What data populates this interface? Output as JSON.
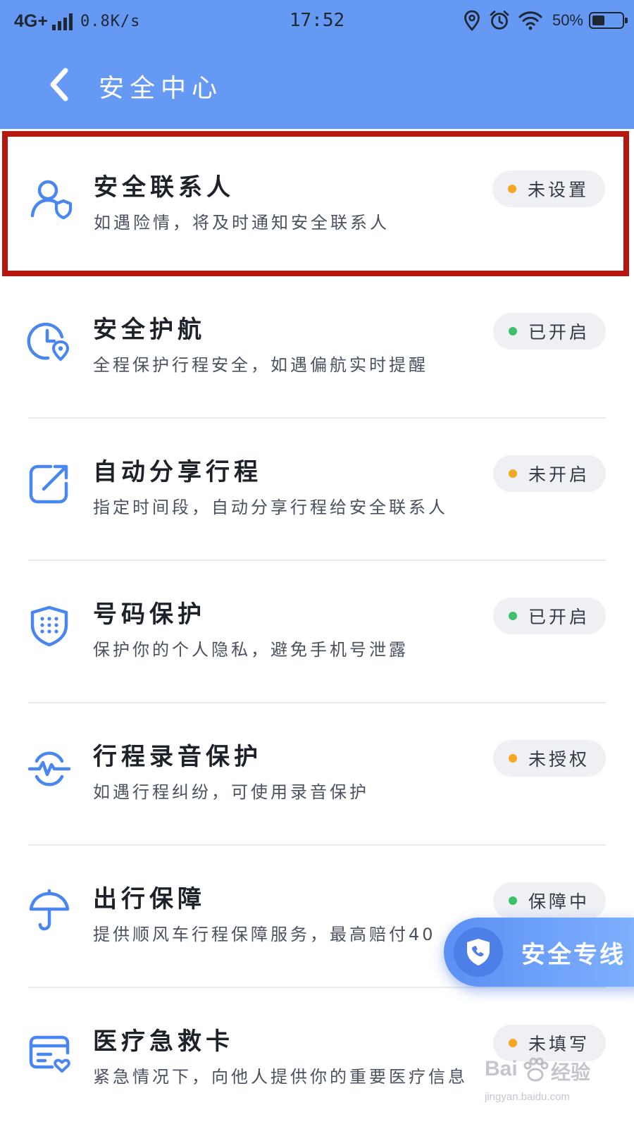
{
  "status_bar": {
    "network": "4G+",
    "speed": "0.8K/s",
    "time": "17:52",
    "battery_percent": "50%",
    "battery_level": 0.5
  },
  "header": {
    "title": "安全中心",
    "back_icon": "chevron-left-icon"
  },
  "items": [
    {
      "title": "安全联系人",
      "subtitle": "如遇险情，将及时通知安全联系人",
      "status": "未设置",
      "status_color": "#f5a623",
      "icon": "contact-shield-icon"
    },
    {
      "title": "安全护航",
      "subtitle": "全程保护行程安全，如遇偏航实时提醒",
      "status": "已开启",
      "status_color": "#3fbf6c",
      "icon": "clock-location-icon"
    },
    {
      "title": "自动分享行程",
      "subtitle": "指定时间段，自动分享行程给安全联系人",
      "status": "未开启",
      "status_color": "#f5a623",
      "icon": "share-arrow-icon"
    },
    {
      "title": "号码保护",
      "subtitle": "保护你的个人隐私，避免手机号泄露",
      "status": "已开启",
      "status_color": "#3fbf6c",
      "icon": "dial-shield-icon"
    },
    {
      "title": "行程录音保护",
      "subtitle": "如遇行程纠纷，可使用录音保护",
      "status": "未授权",
      "status_color": "#f5a623",
      "icon": "recording-wave-icon"
    },
    {
      "title": "出行保障",
      "subtitle": "提供顺风车行程保障服务，最高赔付40",
      "status": "保障中",
      "status_color": "#3fbf6c",
      "icon": "umbrella-icon"
    },
    {
      "title": "医疗急救卡",
      "subtitle": "紧急情况下，向他人提供你的重要医疗信息",
      "status": "未填写",
      "status_color": "#f5a623",
      "icon": "medical-card-icon"
    }
  ],
  "hotline": {
    "label": "安全专线",
    "icon": "phone-shield-icon"
  },
  "watermark": {
    "brand": "Bai",
    "brand_cn": "经验",
    "url": "jingyan.baidu.com"
  },
  "colors": {
    "header_bg": "#6699f4",
    "accent_icon": "#4a86f0",
    "highlight_border": "#b5160f",
    "status_orange": "#f5a623",
    "status_green": "#3fbf6c"
  }
}
